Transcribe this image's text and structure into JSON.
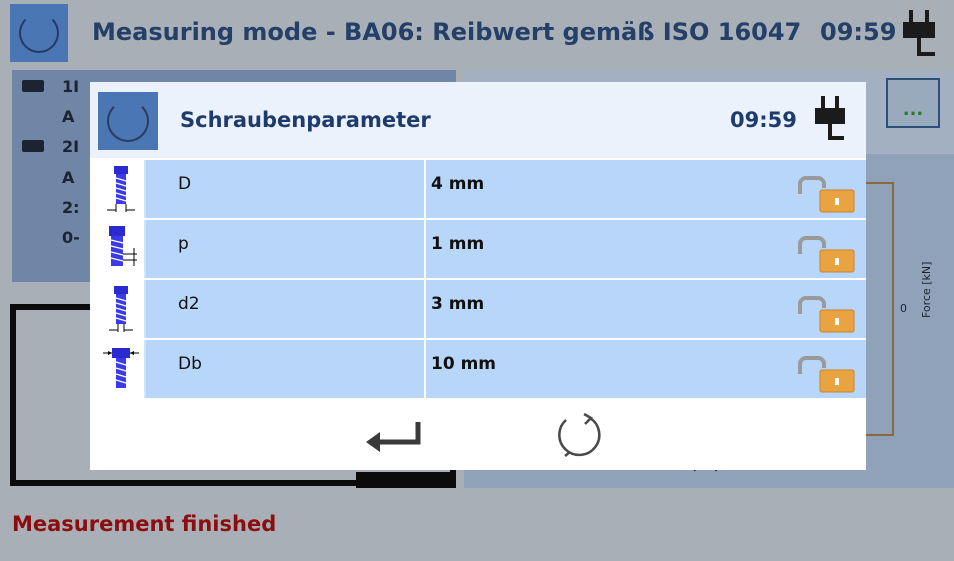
{
  "header": {
    "title": "Measuring mode - BA06: Reibwert gemäß ISO 16047",
    "time": "09:59",
    "cycle_icon": "cycle-icon",
    "plug_icon": "power-plug-icon"
  },
  "background": {
    "left_panel_lines": [
      "1I",
      "A",
      "2I",
      "A",
      "2:",
      "0-"
    ],
    "more_button_label": "...",
    "chart": {
      "y_tick": "0",
      "y_label": "Force [kN]",
      "x_label": "t [sec]"
    },
    "status": "Measurement finished"
  },
  "dialog": {
    "title": "Schraubenparameter",
    "time": "09:59",
    "rows": [
      {
        "name": "D",
        "value": "4 mm",
        "icon": "screw-diameter-icon",
        "locked": true
      },
      {
        "name": "p",
        "value": "1 mm",
        "icon": "screw-pitch-icon",
        "locked": true
      },
      {
        "name": "d2",
        "value": "3 mm",
        "icon": "screw-pitch-diameter-icon",
        "locked": true
      },
      {
        "name": "Db",
        "value": "10 mm",
        "icon": "screw-head-diameter-icon",
        "locked": true
      }
    ],
    "footer": {
      "enter_icon": "enter-icon",
      "reset_icon": "refresh-icon"
    }
  },
  "colors": {
    "title_blue": "#1e3b6e",
    "row_blue": "#b7d6f9",
    "lock_orange": "#e9a441",
    "status_red": "#8b0d0d"
  }
}
